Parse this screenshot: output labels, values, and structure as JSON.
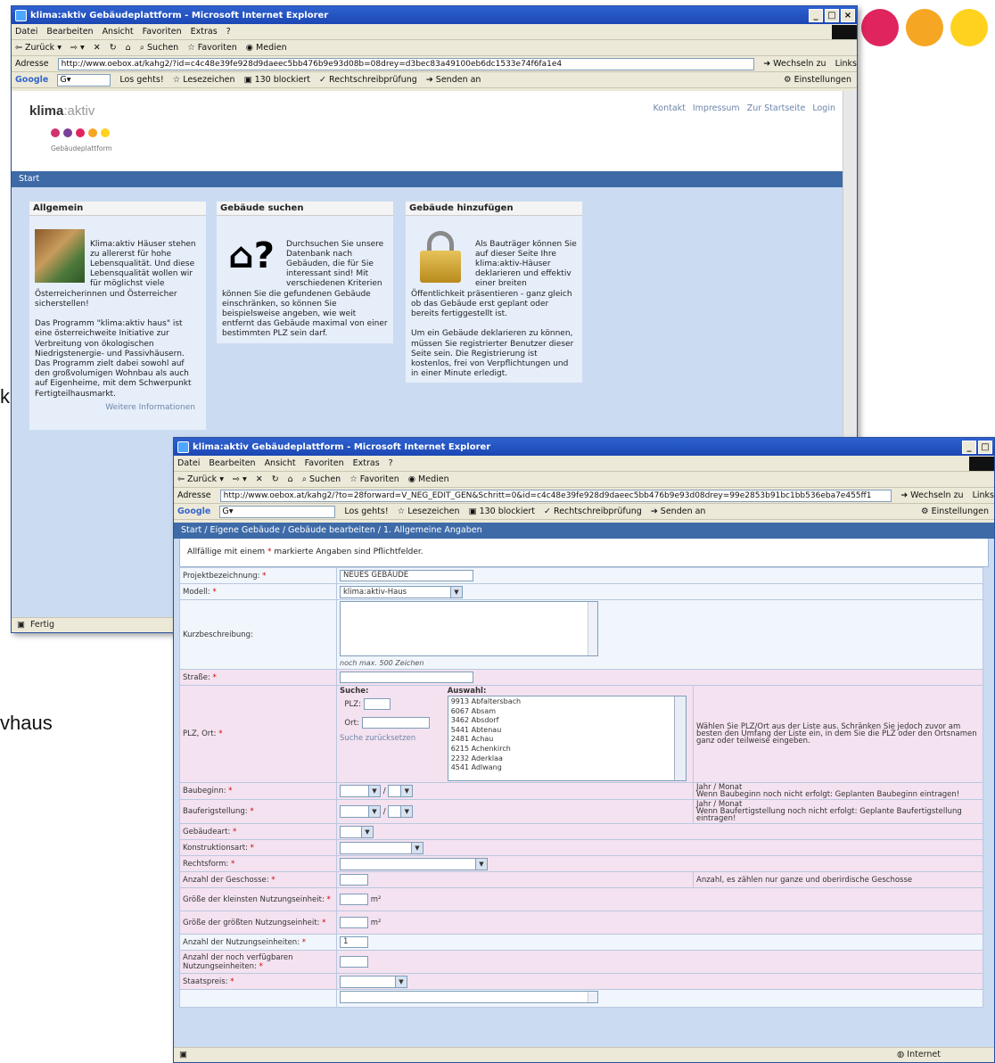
{
  "slide": {
    "dot_colors": [
      "#e0245e",
      "#f5a623",
      "#ffd21f"
    ],
    "bg_text_1": "k",
    "bg_text_2": "vhaus"
  },
  "win1": {
    "title": "klima:aktiv Gebäudeplattform - Microsoft Internet Explorer",
    "menu": [
      "Datei",
      "Bearbeiten",
      "Ansicht",
      "Favoriten",
      "Extras",
      "?"
    ],
    "toolbar": [
      "Zurück",
      "Suchen",
      "Favoriten",
      "Medien"
    ],
    "address_label": "Adresse",
    "address": "http://www.oebox.at/kahg2/?id=c4c48e39fe928d9daeec5bb476b9e93d08b=08drey=d3bec83a49100eb6dc1533e74f6fa1e4",
    "go_label": "Wechseln zu",
    "links_label": "Links",
    "google_label": "Google",
    "google_bar": [
      "Los gehts!",
      "Lesezeichen",
      "130 blockiert",
      "Rechtschreibprüfung",
      "Senden an"
    ],
    "settings_label": "Einstellungen",
    "status": "Fertig",
    "logo_main": "klima",
    "logo_sep": ":",
    "logo_aktiv": "aktiv",
    "logo_sub": "Gebäudeplattform",
    "logo_dots": [
      "#d1336d",
      "#7b3f99",
      "#e0245e",
      "#f5a623",
      "#ffd21f"
    ],
    "top_links": [
      "Kontakt",
      "Impressum",
      "Zur Startseite",
      "Login"
    ],
    "nav": "Start",
    "columns": [
      {
        "heading": "Allgemein",
        "text": "Klima:aktiv Häuser stehen zu allererst für hohe Lebensqualität. Und diese Lebensqualität wollen wir für möglichst viele Österreicherinnen und Österreicher sicherstellen!\n\nDas Programm \"klima:aktiv haus\" ist eine österreichweite Initiative zur Verbreitung von ökologischen Niedrigstenergie- und Passivhäusern. Das Programm zielt dabei sowohl auf den großvolumigen Wohnbau als auch auf Eigenheime, mit dem Schwerpunkt Fertigteilhausmarkt.",
        "more": "Weitere Informationen"
      },
      {
        "heading": "Gebäude suchen",
        "text": "Durchsuchen Sie unsere Datenbank nach Gebäuden, die für Sie interessant sind! Mit verschiedenen Kriterien können Sie die gefundenen Gebäude einschränken, so können Sie beispielsweise angeben, wie weit entfernt das Gebäude maximal von einer bestimmten PLZ sein darf."
      },
      {
        "heading": "Gebäude hinzufügen",
        "text": "Als Bauträger können Sie auf dieser Seite Ihre klima:aktiv-Häuser deklarieren und effektiv einer breiten Öffentlichkeit präsentieren - ganz gleich ob das Gebäude erst geplant oder bereits fertiggestellt ist.\n\nUm ein Gebäude deklarieren zu können, müssen Sie registrierter Benutzer dieser Seite sein. Die Registrierung ist kostenlos, frei von Verpflichtungen und in einer Minute erledigt."
      }
    ]
  },
  "win2": {
    "title": "klima:aktiv Gebäudeplattform - Microsoft Internet Explorer",
    "menu": [
      "Datei",
      "Bearbeiten",
      "Ansicht",
      "Favoriten",
      "Extras",
      "?"
    ],
    "toolbar": [
      "Zurück",
      "Suchen",
      "Favoriten",
      "Medien"
    ],
    "address_label": "Adresse",
    "address": "http://www.oebox.at/kahg2/?to=28forward=V_NEG_EDIT_GEN&Schritt=0&id=c4c48e39fe928d9daeec5bb476b9e93d08drey=99e2853b91bc1bb536eba7e455ff1",
    "go_label": "Wechseln zu",
    "links_label": "Links",
    "google_label": "Google",
    "google_bar": [
      "Los gehts!",
      "Lesezeichen",
      "130 blockiert",
      "Rechtschreibprüfung",
      "Senden an"
    ],
    "settings_label": "Einstellungen",
    "status_zone": "Internet",
    "breadcrumb": "Start / Eigene Gebäude / Gebäude bearbeiten / 1. Allgemeine Angaben",
    "note_pre": "Allfällige mit einem ",
    "note_star": "*",
    "note_post": " markierte Angaben sind Pflichtfelder.",
    "fields": {
      "projekt_label": "Projektbezeichnung:",
      "projekt_value": "NEUES GEBÄUDE",
      "modell_label": "Modell:",
      "modell_value": "klima:aktiv-Haus",
      "kurz_label": "Kurzbeschreibung:",
      "kurz_hint": "noch max. 500 Zeichen",
      "strasse_label": "Straße:",
      "plz_label": "PLZ, Ort:",
      "suche_head": "Suche:",
      "plz_sub": "PLZ:",
      "ort_sub": "Ort:",
      "suche_reset": "Suche zurücksetzen",
      "auswahl_head": "Auswahl:",
      "auswahl_options": [
        "9913 Abfaltersbach",
        "6067 Absam",
        "3462 Absdorf",
        "5441 Abtenau",
        "2481 Achau",
        "6215 Achenkirch",
        "2232 Aderklaa",
        "4541 Adlwang"
      ],
      "plz_hint": "Wählen Sie PLZ/Ort aus der Liste aus. Schränken Sie jedoch zuvor am besten den Umfang der Liste ein, in dem Sie die PLZ oder den Ortsnamen ganz oder teilweise eingeben.",
      "baubeginn_label": "Baubeginn:",
      "baubeginn_hint": "Jahr / Monat\nWenn Baubeginn noch nicht erfolgt: Geplanten Baubeginn eintragen!",
      "fertig_label": "Bauferigstellung:",
      "fertig_hint": "Jahr / Monat\nWenn Baufertigstellung noch nicht erfolgt: Geplante Baufertigstellung eintragen!",
      "gebaeudeart_label": "Gebäudeart:",
      "konstruktion_label": "Konstruktionsart:",
      "rechtsform_label": "Rechtsform:",
      "geschosse_label": "Anzahl der Geschosse:",
      "geschosse_hint": "Anzahl, es zählen nur ganze und oberirdische Geschosse",
      "kleinste_label": "Größe der kleinsten Nutzungseinheit:",
      "groesste_label": "Größe der größten Nutzungseinheit:",
      "unit_m2": "m²",
      "anzahl_ne_label": "Anzahl der Nutzungseinheiten:",
      "anzahl_ne_value": "1",
      "verfuegbar_label": "Anzahl der noch verfügbaren Nutzungseinheiten:",
      "staatspreis_label": "Staatspreis:",
      "slash": "/",
      "star": "*"
    }
  }
}
